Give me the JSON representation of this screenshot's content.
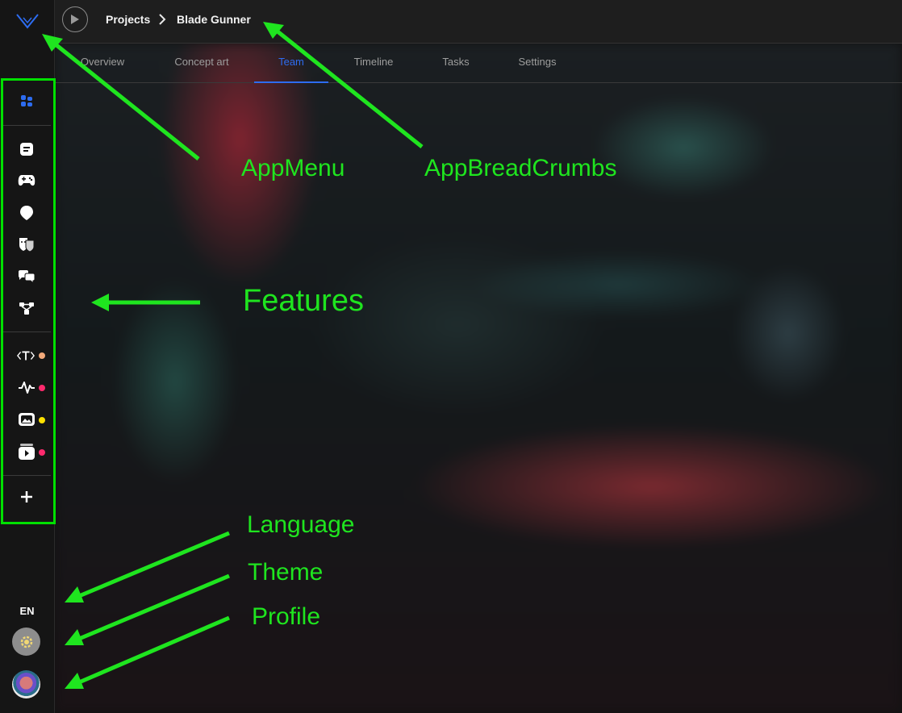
{
  "breadcrumbs": [
    "Projects",
    "Blade Gunner"
  ],
  "tabs": [
    {
      "label": "Overview",
      "active": false
    },
    {
      "label": "Concept art",
      "active": false
    },
    {
      "label": "Team",
      "active": true
    },
    {
      "label": "Timeline",
      "active": false
    },
    {
      "label": "Tasks",
      "active": false
    },
    {
      "label": "Settings",
      "active": false
    }
  ],
  "sidebar": {
    "features": [
      {
        "icon": "dashboard-icon"
      },
      {
        "icon": "document-icon"
      },
      {
        "icon": "gamepad-icon"
      },
      {
        "icon": "location-pin-icon"
      },
      {
        "icon": "masks-icon"
      },
      {
        "icon": "chat-bubbles-icon"
      },
      {
        "icon": "flow-icon"
      },
      {
        "icon": "text-tag-icon",
        "status_color": "#f2a97a"
      },
      {
        "icon": "activity-icon",
        "status_color": "#ff2a6d"
      },
      {
        "icon": "gallery-icon",
        "status_color": "#ffe100"
      },
      {
        "icon": "video-icon",
        "status_color": "#ff2a6d"
      },
      {
        "icon": "add-icon"
      }
    ],
    "language": "EN",
    "theme_icon": "gear-icon",
    "profile_icon": "avatar"
  },
  "annotations": {
    "app_menu": "AppMenu",
    "app_breadcrumbs": "AppBreadCrumbs",
    "features": "Features",
    "language": "Language",
    "theme": "Theme",
    "profile": "Profile"
  },
  "colors": {
    "accent": "#2d6cf0",
    "annotation": "#1fe51f",
    "sidebar_bg": "#151515",
    "topbar_bg": "#1e1e1e"
  }
}
